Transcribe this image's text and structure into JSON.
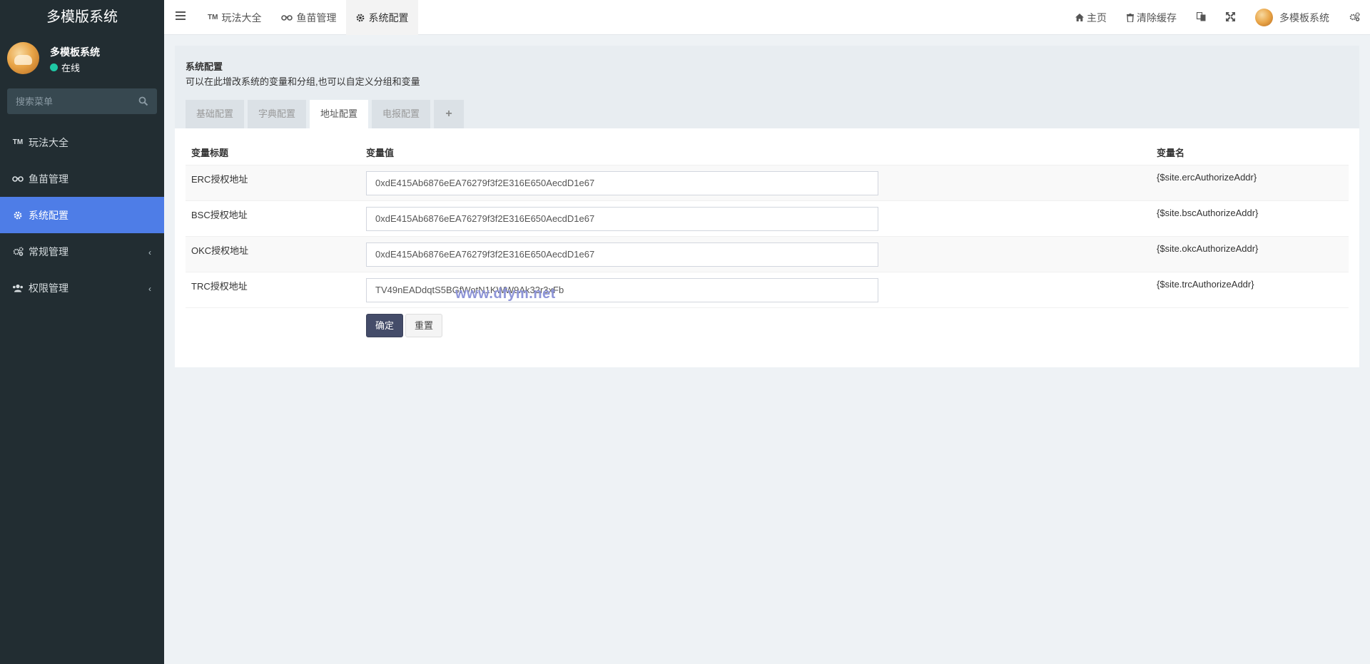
{
  "sidebar": {
    "logo": "多模版系统",
    "user": {
      "name": "多模板系统",
      "status": "在线"
    },
    "search": {
      "placeholder": "搜索菜单"
    },
    "items": [
      {
        "label": "玩法大全",
        "icon": "tm-icon"
      },
      {
        "label": "鱼苗管理",
        "icon": "binoculars-icon"
      },
      {
        "label": "系统配置",
        "icon": "gear-icon",
        "active": true
      },
      {
        "label": "常规管理",
        "icon": "gears-icon"
      },
      {
        "label": "权限管理",
        "icon": "users-icon"
      }
    ]
  },
  "topbar": {
    "tabs": [
      {
        "label": "玩法大全",
        "icon": "tm-icon"
      },
      {
        "label": "鱼苗管理",
        "icon": "binoculars-icon"
      },
      {
        "label": "系统配置",
        "icon": "gear-icon",
        "active": true
      }
    ],
    "home": "主页",
    "clear_cache": "清除缓存",
    "username": "多模板系统"
  },
  "panel": {
    "title": "系统配置",
    "description": "可以在此增改系统的变量和分组,也可以自定义分组和变量",
    "tabs": [
      "基础配置",
      "字典配置",
      "地址配置",
      "电报配置"
    ],
    "active_tab": "地址配置",
    "add_tab": "+"
  },
  "table": {
    "headers": [
      "变量标题",
      "变量值",
      "变量名"
    ],
    "rows": [
      {
        "title": "ERC授权地址",
        "value": "0xdE415Ab6876eEA76279f3f2E316E650AecdD1e67",
        "name": "{$site.ercAuthorizeAddr}"
      },
      {
        "title": "BSC授权地址",
        "value": "0xdE415Ab6876eEA76279f3f2E316E650AecdD1e67",
        "name": "{$site.bscAuthorizeAddr}"
      },
      {
        "title": "OKC授权地址",
        "value": "0xdE415Ab6876eEA76279f3f2E316E650AecdD1e67",
        "name": "{$site.okcAuthorizeAddr}"
      },
      {
        "title": "TRC授权地址",
        "value": "TV49nEADdqtS5BGfWotN1KWW9Ak32r3xFb",
        "name": "{$site.trcAuthorizeAddr}"
      }
    ]
  },
  "buttons": {
    "confirm": "确定",
    "reset": "重置"
  },
  "watermark": "www.dfym.net",
  "colors": {
    "sidebar_bg": "#222d32",
    "active": "#4e7de7",
    "online": "#1fc8a5",
    "confirm_btn": "#444c69"
  }
}
